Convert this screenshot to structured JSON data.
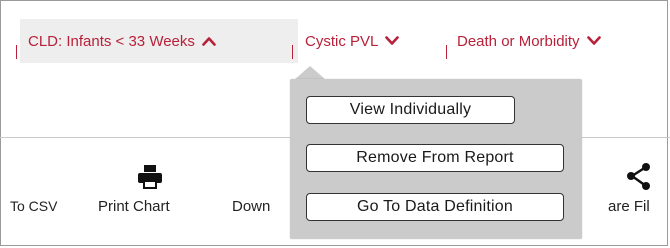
{
  "tabs": [
    {
      "label": "CLD: Infants < 33 Weeks",
      "state": "expanded"
    },
    {
      "label": "Cystic PVL",
      "state": "collapsed"
    },
    {
      "label": "Death or Morbidity",
      "state": "collapsed"
    }
  ],
  "toolbar": {
    "csv_label": "To CSV",
    "print_label": "Print Chart",
    "download_label": "Down",
    "share_label": "are Fil"
  },
  "popup_menu": {
    "items": [
      "View Individually",
      "Remove From Report",
      "Go To Data Definition"
    ]
  },
  "colors": {
    "accent": "#b8213a",
    "active_tab_bg": "#eeeeee",
    "popup_bg": "#cbcbcb"
  }
}
